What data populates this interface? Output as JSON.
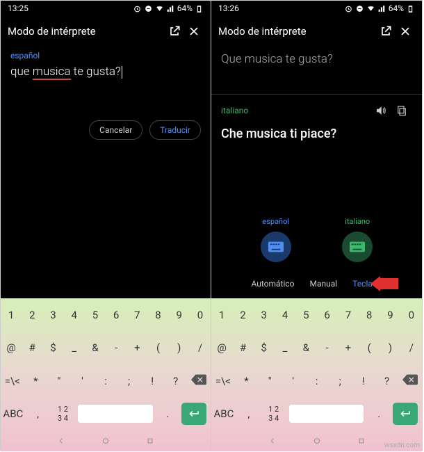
{
  "left": {
    "time": "13:25",
    "battery": "64%",
    "title": "Modo de intérprete",
    "srcLang": "español",
    "inputPre": "que ",
    "inputUnd": "musica",
    "inputPost": " te gusta?",
    "cancel": "Cancelar",
    "translate": "Traducir"
  },
  "right": {
    "time": "13:26",
    "battery": "64%",
    "title": "Modo de intérprete",
    "srcText": "Que musica te gusta?",
    "tgtLang": "italiano",
    "tgtText": "Che musica ti piace?",
    "langA": "español",
    "langB": "italiano",
    "modeAuto": "Automático",
    "modeManual": "Manual",
    "modeKb": "Teclado"
  },
  "kb": {
    "r1": [
      "1",
      "2",
      "3",
      "4",
      "5",
      "6",
      "7",
      "8",
      "9",
      "0"
    ],
    "r2": [
      "@",
      "#",
      "$",
      "_",
      "&",
      "-",
      "+",
      "(",
      ")",
      "/"
    ],
    "r3": [
      "=\\<",
      "*",
      "\"",
      "'",
      ":",
      ";",
      "!",
      "?"
    ],
    "abc": "ABC",
    "nums": "1 2\n3 4",
    "comma": ",",
    "dot": "."
  },
  "watermark": "wsxdn.com"
}
